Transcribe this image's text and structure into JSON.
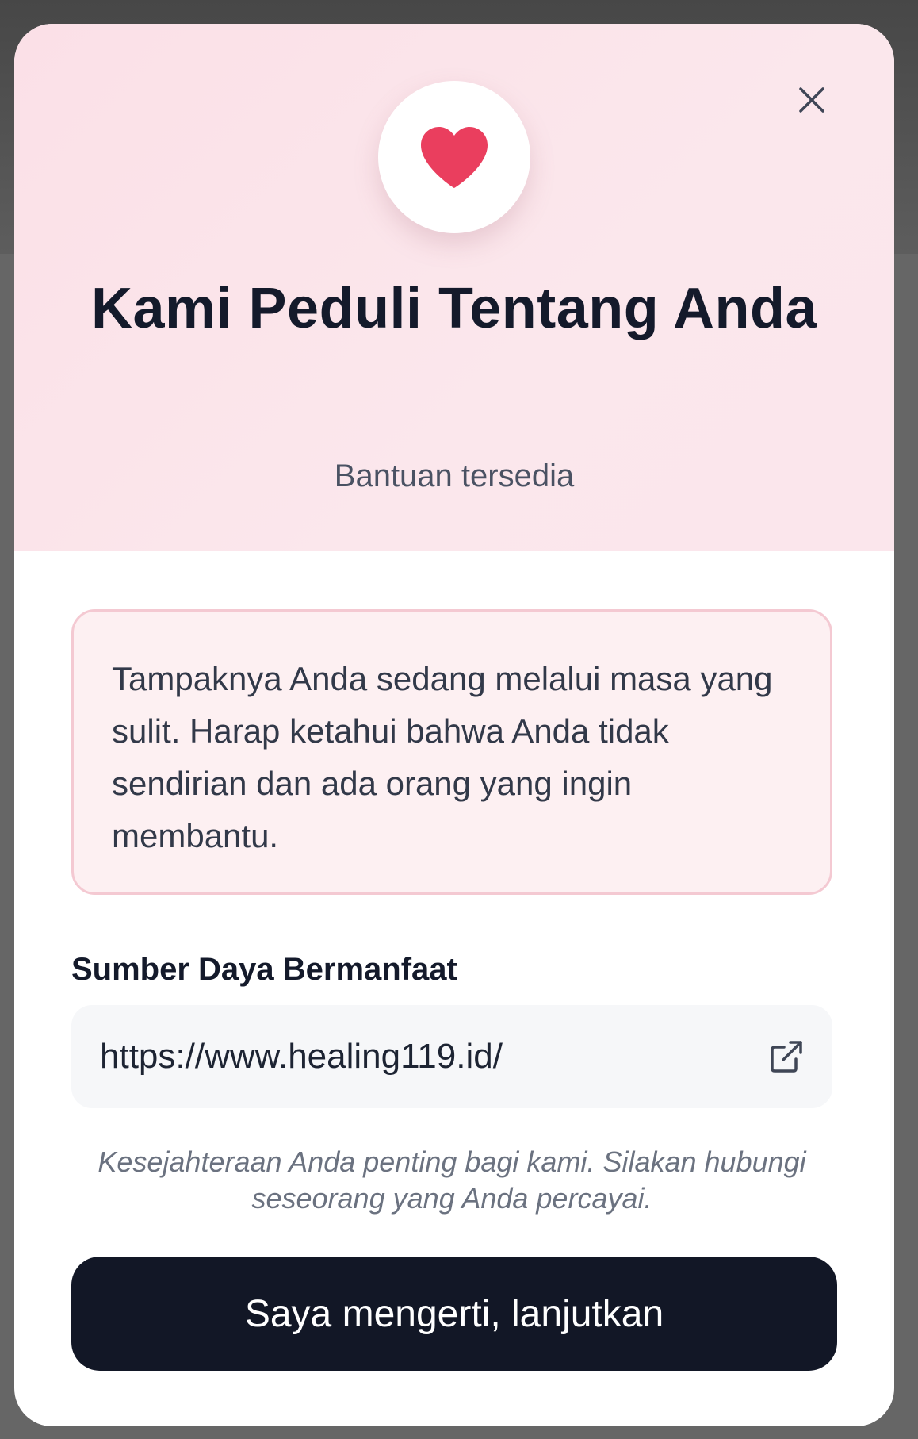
{
  "dialog": {
    "title": "Kami Peduli Tentang Anda",
    "subtitle": "Bantuan tersedia",
    "message": "Tampaknya Anda sedang melalui masa yang sulit. Harap ketahui bahwa Anda tidak sendirian dan ada orang yang ingin membantu.",
    "resources_heading": "Sumber Daya Bermanfaat",
    "resources": [
      {
        "url": "https://www.healing119.id/"
      }
    ],
    "note": "Kesejahteraan Anda penting bagi kami. Silakan hubungi seseorang yang Anda percayai.",
    "confirm_label": "Saya mengerti, lanjutkan",
    "icons": {
      "header": "heart-icon",
      "close": "close-icon",
      "link": "external-link-icon"
    }
  },
  "colors": {
    "header_bg": "#fbe4ea",
    "heart": "#ea3e5e",
    "alert_bg": "#fdf0f2",
    "alert_border": "#f4c9d2",
    "primary_button": "#121726",
    "title_text": "#141a2b"
  }
}
